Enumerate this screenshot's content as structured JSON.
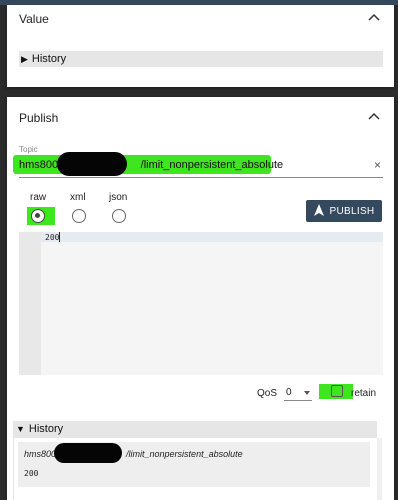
{
  "value_panel": {
    "title": "Value",
    "history_label": "History"
  },
  "publish_panel": {
    "title": "Publish",
    "topic_label": "Topic",
    "topic_value": "hms800/                          /limit_nonpersistent_absolute",
    "clear_symbol": "×",
    "formats": [
      "raw",
      "xml",
      "json"
    ],
    "selected_format": "raw",
    "publish_button": "PUBLISH",
    "editor_content": "200",
    "qos_label": "QoS",
    "qos_value": "0",
    "retain_label": "retain",
    "retain_checked": false,
    "history_label": "History",
    "history_entry_topic": "hms800/                           /limit_nonpersistent_absolute",
    "history_entry_payload": "200"
  },
  "icons": {
    "panel_collapse": "chevron-up-icon",
    "publish": "navigation-arrow-icon",
    "history_toggle": "triangle-icon"
  },
  "colors": {
    "accent": "#35495e",
    "highlight": "#3fe51f",
    "redaction": "#050505"
  }
}
